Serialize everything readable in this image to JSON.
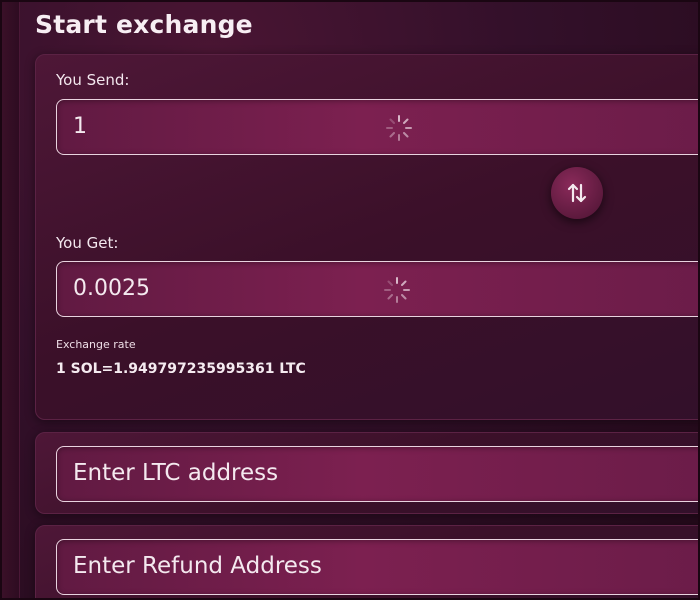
{
  "page": {
    "title": "Start exchange"
  },
  "send": {
    "label": "You Send:",
    "value": "1"
  },
  "get": {
    "label": "You Get:",
    "value": "0.0025"
  },
  "rate": {
    "label": "Exchange rate",
    "value": "1 SOL=1.949797235995361 LTC"
  },
  "address": {
    "placeholder": "Enter LTC address"
  },
  "refund": {
    "placeholder": "Enter Refund Address"
  },
  "icons": {
    "swap": "swap-vertical-arrows-icon",
    "loading": "loading-spinner-icon"
  },
  "colors": {
    "background": "#2b0c1f",
    "card": "#3b1029",
    "field": "#7c2050",
    "field_border": "#e9d3df",
    "text": "#f2e6ec"
  }
}
